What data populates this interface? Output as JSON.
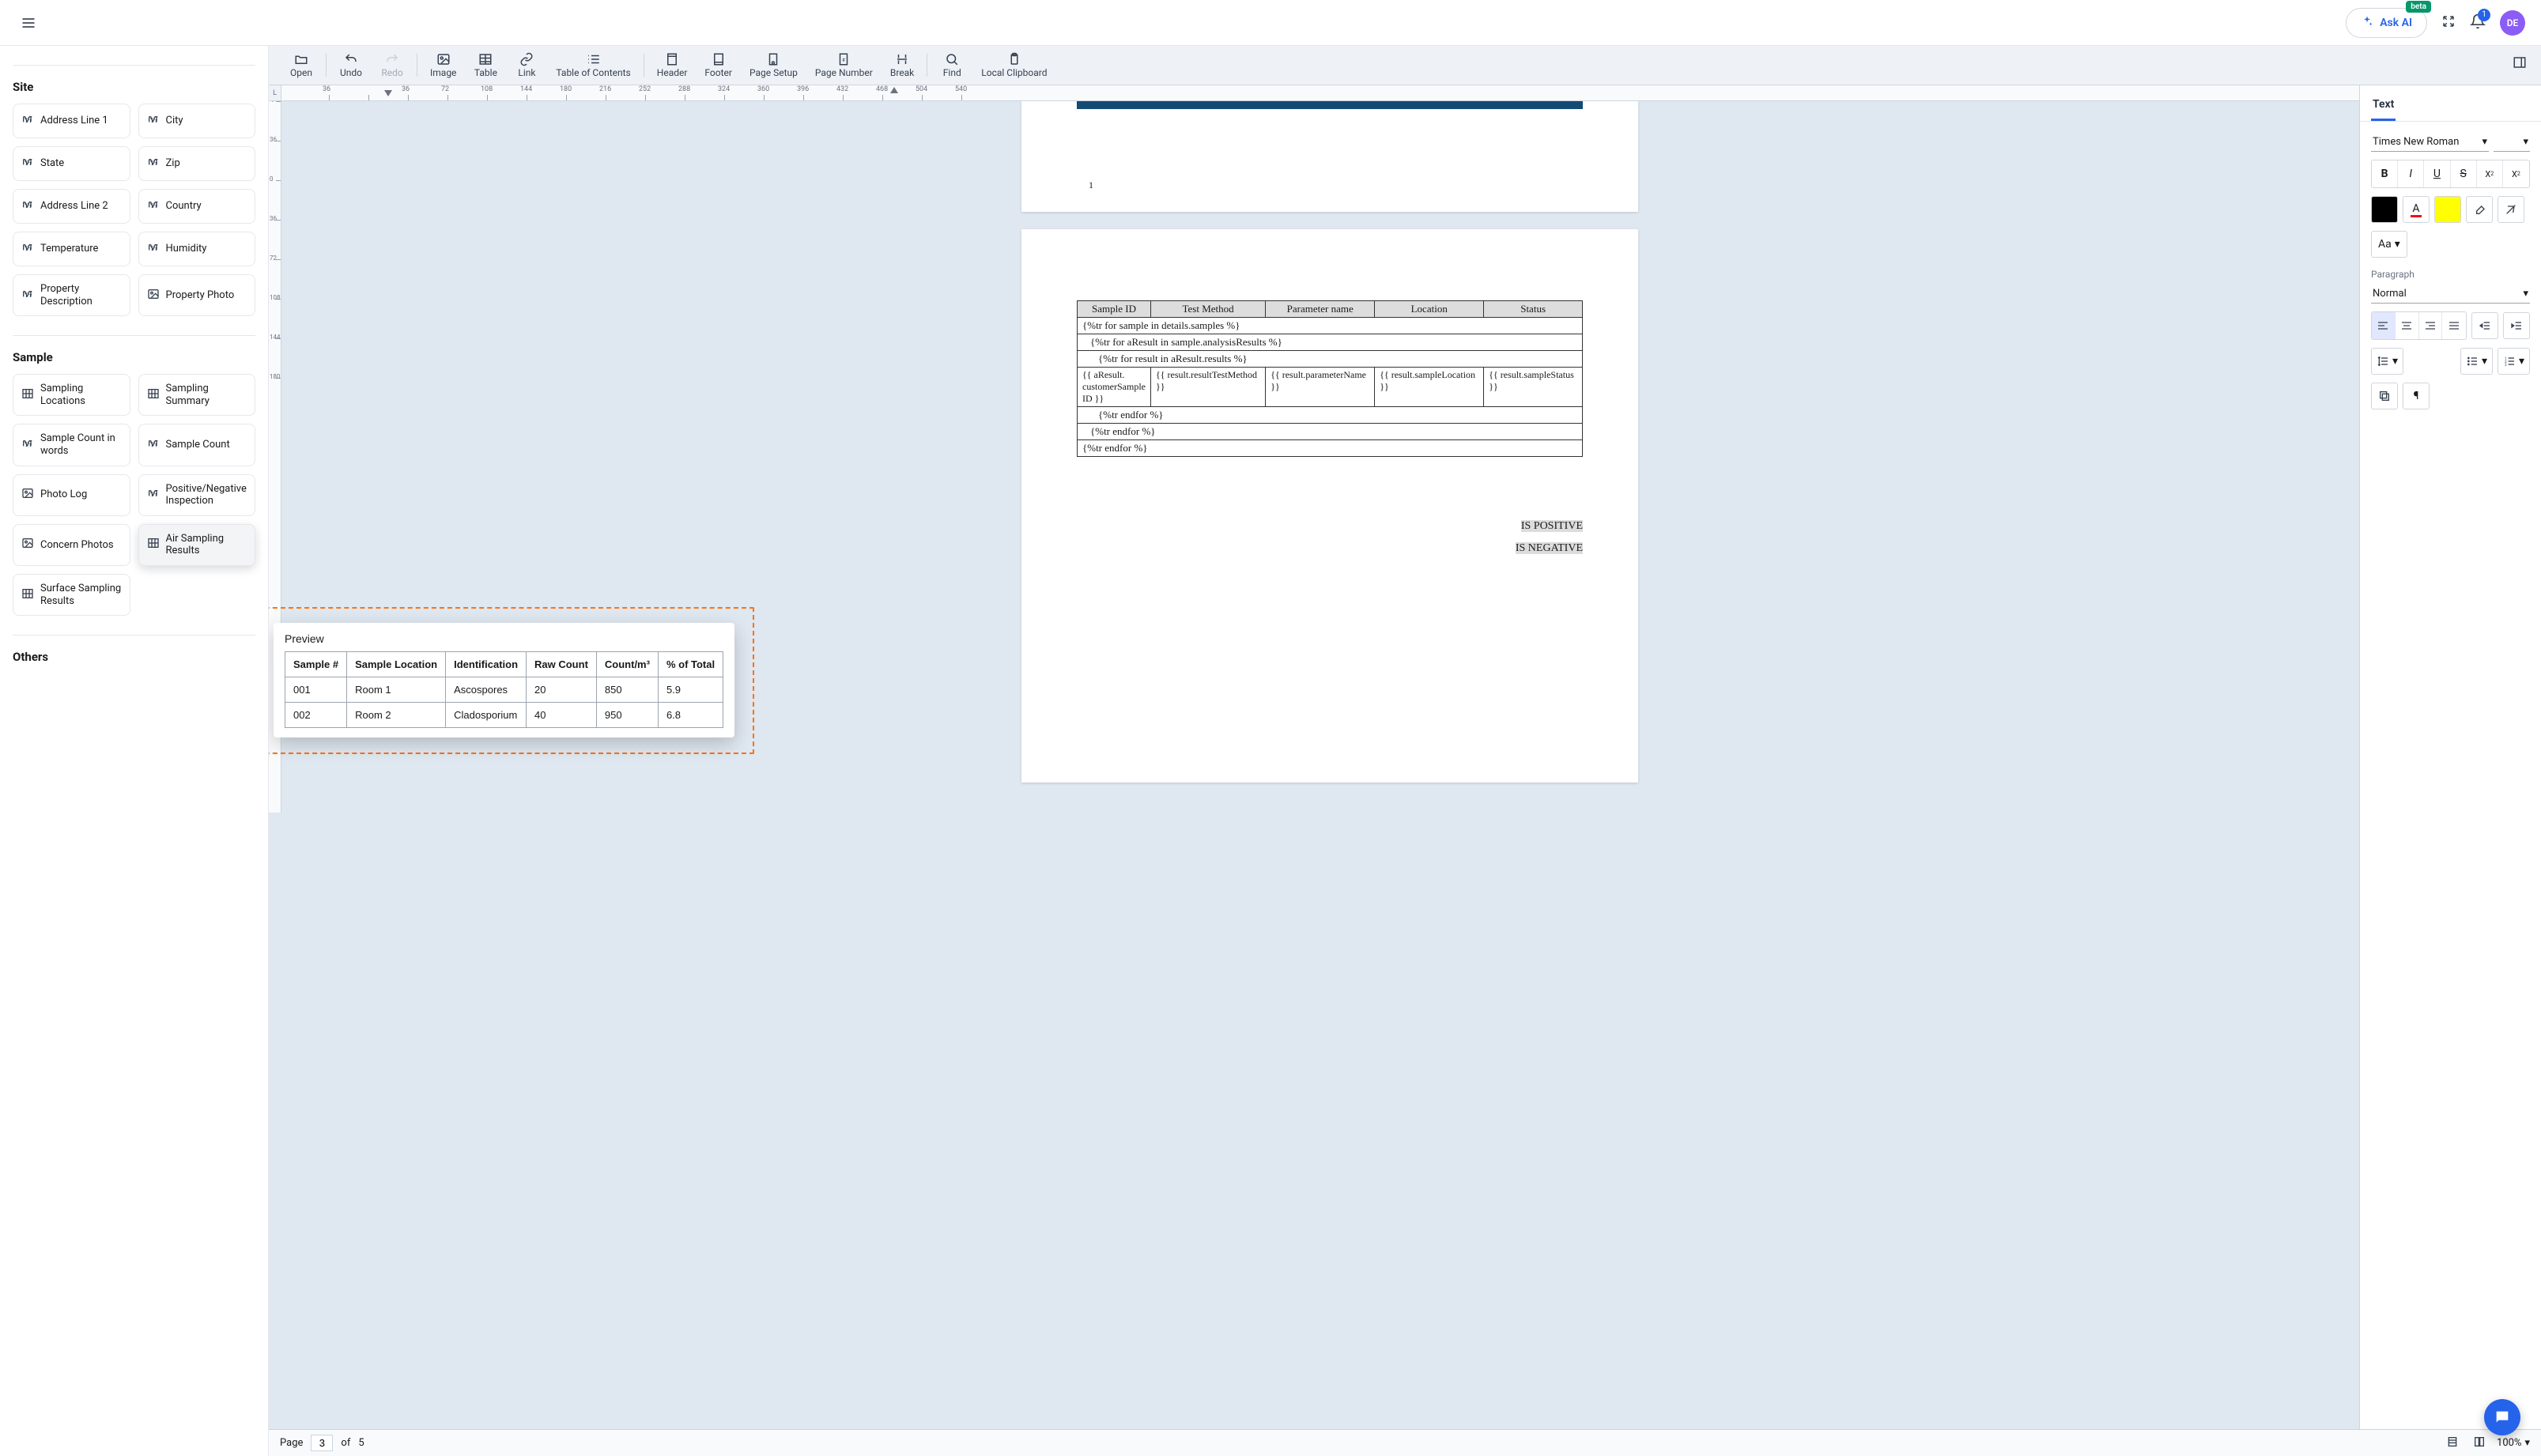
{
  "header": {
    "ask_ai_label": "Ask AI",
    "beta_label": "beta",
    "bell_count": "1",
    "avatar_initials": "DE"
  },
  "left_sidebar": {
    "sections": [
      {
        "title": "Site",
        "chips": [
          {
            "label": "Address Line 1",
            "icon": "text"
          },
          {
            "label": "City",
            "icon": "text"
          },
          {
            "label": "State",
            "icon": "text"
          },
          {
            "label": "Zip",
            "icon": "text"
          },
          {
            "label": "Address Line 2",
            "icon": "text"
          },
          {
            "label": "Country",
            "icon": "text"
          },
          {
            "label": "Temperature",
            "icon": "text"
          },
          {
            "label": "Humidity",
            "icon": "text"
          },
          {
            "label": "Property Description",
            "icon": "text"
          },
          {
            "label": "Property Photo",
            "icon": "image"
          }
        ]
      },
      {
        "title": "Sample",
        "chips": [
          {
            "label": "Sampling Locations",
            "icon": "table"
          },
          {
            "label": "Sampling Summary",
            "icon": "table"
          },
          {
            "label": "Sample Count in words",
            "icon": "text"
          },
          {
            "label": "Sample Count",
            "icon": "text"
          },
          {
            "label": "Photo Log",
            "icon": "image"
          },
          {
            "label": "Positive/Negative Inspection",
            "icon": "text"
          },
          {
            "label": "Concern Photos",
            "icon": "image"
          },
          {
            "label": "Air Sampling Results",
            "icon": "table"
          },
          {
            "label": "Surface Sampling Results",
            "icon": "table"
          }
        ]
      },
      {
        "title": "Others",
        "chips": []
      }
    ]
  },
  "toolbar": {
    "open": "Open",
    "undo": "Undo",
    "redo": "Redo",
    "image": "Image",
    "table": "Table",
    "link": "Link",
    "toc": "Table of Contents",
    "header": "Header",
    "footer": "Footer",
    "page_setup": "Page Setup",
    "page_number": "Page Number",
    "break": "Break",
    "find": "Find",
    "local_clipboard": "Local Clipboard"
  },
  "ruler": {
    "h_ticks": [
      "36",
      "",
      "36",
      "72",
      "108",
      "144",
      "180",
      "216",
      "252",
      "288",
      "324",
      "360",
      "396",
      "432",
      "468",
      "504",
      "540"
    ],
    "v_ticks": [
      "-7",
      "36",
      "0",
      "36",
      "72",
      "108",
      "144",
      "180"
    ],
    "corner_label": "L"
  },
  "document": {
    "page_remnant_number": "1",
    "table_headers": [
      "Sample ID",
      "Test Method",
      "Parameter name",
      "Location",
      "Status"
    ],
    "template_rows": [
      "{%tr for sample in details.samples %}",
      "{%tr for aResult in sample.analysisResults %}",
      "{%tr for result in aResult.results %}"
    ],
    "binding_cells": [
      "{{ aResult.\ncustomerSample\nID }}",
      "{{ result.resultTestMethod }}",
      "{{ result.parameterName }}",
      "{{ result.sampleLocation }}",
      "{{ result.sampleStatus }}"
    ],
    "endfor_rows": [
      "{%tr endfor %}",
      "{%tr endfor %}",
      "{%tr endfor %}"
    ],
    "positive_text": "IS POSITIVE",
    "negative_text": "IS NEGATIVE"
  },
  "preview": {
    "title": "Preview",
    "drag_label": "Air Sampling Results",
    "headers": [
      "Sample #",
      "Sample Location",
      "Identification",
      "Raw Count",
      "Count/m³",
      "% of Total"
    ],
    "rows": [
      [
        "001",
        "Room 1",
        "Ascospores",
        "20",
        "850",
        "5.9"
      ],
      [
        "002",
        "Room 2",
        "Cladosporium",
        "40",
        "950",
        "6.8"
      ]
    ]
  },
  "right_panel": {
    "tab": "Text",
    "font_family": "Times New Roman",
    "font_size_placeholder": "",
    "case_label": "Aa",
    "paragraph_label": "Paragraph",
    "paragraph_style": "Normal",
    "text_color": "#000000",
    "highlight_color": "#ffff00"
  },
  "status_bar": {
    "page_label": "Page",
    "current_page": "3",
    "of_label": "of",
    "total_pages": "5",
    "zoom": "100%"
  }
}
